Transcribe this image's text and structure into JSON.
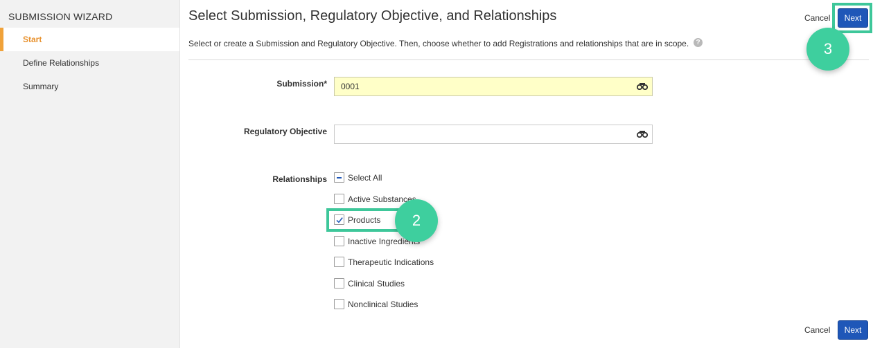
{
  "sidebar": {
    "title": "SUBMISSION WIZARD",
    "items": [
      {
        "label": "Start",
        "active": true
      },
      {
        "label": "Define Relationships",
        "active": false
      },
      {
        "label": "Summary",
        "active": false
      }
    ]
  },
  "header": {
    "title": "Select Submission, Regulatory Objective, and Relationships",
    "subtitle": "Select or create a Submission and Regulatory Objective. Then, choose whether to add Registrations and relationships that are in scope.",
    "help_icon": "?",
    "cancel_label": "Cancel",
    "next_label": "Next"
  },
  "form": {
    "submission": {
      "label": "Submission*",
      "value": "0001"
    },
    "regulatory_objective": {
      "label": "Regulatory Objective",
      "value": ""
    },
    "relationships": {
      "label": "Relationships",
      "select_all": {
        "label": "Select All",
        "state": "indeterminate"
      },
      "options": [
        {
          "label": "Active Substances",
          "checked": false
        },
        {
          "label": "Products",
          "checked": true
        },
        {
          "label": "Inactive Ingredients",
          "checked": false
        },
        {
          "label": "Therapeutic Indications",
          "checked": false
        },
        {
          "label": "Clinical Studies",
          "checked": false
        },
        {
          "label": "Nonclinical Studies",
          "checked": false
        }
      ]
    }
  },
  "footer": {
    "cancel_label": "Cancel",
    "next_label": "Next"
  },
  "annotations": {
    "step_2": "2",
    "step_3": "3",
    "accent_color": "#3ecf9e"
  },
  "colors": {
    "primary_button": "#1f57b8",
    "active_nav": "#e8912d",
    "required_field": "#ffffc8"
  }
}
